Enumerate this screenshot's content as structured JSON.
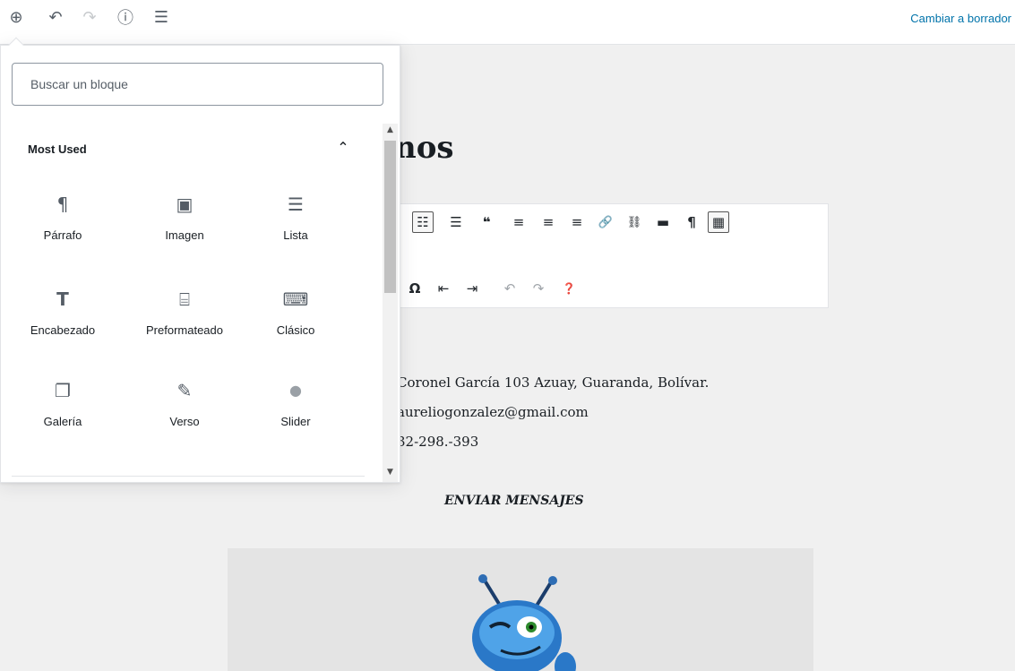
{
  "topbar": {
    "add_icon": "⊕",
    "undo_icon": "↶",
    "redo_icon": "↷",
    "info_icon": "ⓘ",
    "outline_icon": "☰",
    "draft_link": "Cambiar a borrador"
  },
  "inserter": {
    "search_placeholder": "Buscar un bloque",
    "panel_title": "Most Used",
    "panel_toggle_icon": "⌃",
    "blocks": [
      {
        "label": "Párrafo",
        "icon": "¶"
      },
      {
        "label": "Imagen",
        "icon": "▣"
      },
      {
        "label": "Lista",
        "icon": "☰"
      },
      {
        "label": "Encabezado",
        "icon": "T"
      },
      {
        "label": "Preformateado",
        "icon": "⌸"
      },
      {
        "label": "Clásico",
        "icon": "⌨"
      },
      {
        "label": "Galería",
        "icon": "❐"
      },
      {
        "label": "Verso",
        "icon": "✎"
      },
      {
        "label": "Slider",
        "icon": "●"
      }
    ]
  },
  "editor": {
    "heading": "nos",
    "classic_toolbar": {
      "row1": [
        "☷",
        "☰",
        "❝",
        "≡",
        "≡",
        "≡",
        "🔗",
        "⛓",
        "▬",
        "¶",
        "▦"
      ],
      "row2": [
        "Ω",
        "⇤",
        "⇥",
        "↶",
        "↷",
        "❓"
      ]
    },
    "contact_lines": [
      "Coronel García 103 Azuay, Guaranda, Bolívar.",
      "aureliogonzalez@gmail.com",
      "32-298.-393"
    ],
    "send_label": "ENVIAR MENSAJES"
  }
}
